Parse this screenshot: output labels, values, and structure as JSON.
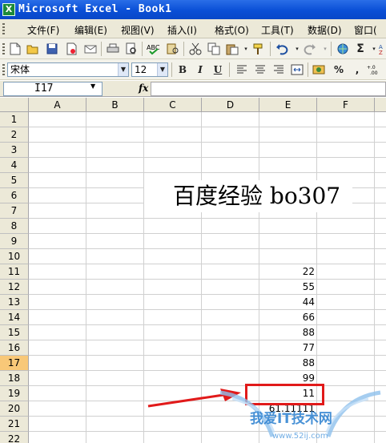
{
  "window": {
    "title": "Microsoft Excel - Book1",
    "app_icon_label": "X"
  },
  "menu": {
    "items": [
      "文件(F)",
      "编辑(E)",
      "视图(V)",
      "插入(I)",
      "格式(O)",
      "工具(T)",
      "数据(D)",
      "窗口("
    ]
  },
  "format_toolbar": {
    "font_name": "宋体",
    "font_size": "12",
    "bold": "B",
    "italic": "I",
    "underline": "U",
    "percent": "%",
    "comma": ","
  },
  "formula_bar": {
    "name_box": "I17",
    "fx": "fx",
    "value": ""
  },
  "columns": [
    "A",
    "B",
    "C",
    "D",
    "E",
    "F"
  ],
  "rows": [
    "1",
    "2",
    "3",
    "4",
    "5",
    "6",
    "7",
    "8",
    "9",
    "10",
    "11",
    "12",
    "13",
    "14",
    "15",
    "16",
    "17",
    "18",
    "19",
    "20",
    "21",
    "22"
  ],
  "active_row": "17",
  "sheet": {
    "heading_text": "百度经验  bo307",
    "column_e_values": [
      {
        "row": "10",
        "value": "22"
      },
      {
        "row": "11",
        "value": "55"
      },
      {
        "row": "12",
        "value": "44"
      },
      {
        "row": "13",
        "value": "66"
      },
      {
        "row": "14",
        "value": "88"
      },
      {
        "row": "15",
        "value": "77"
      },
      {
        "row": "16",
        "value": "88"
      },
      {
        "row": "17",
        "value": "99"
      },
      {
        "row": "18",
        "value": "11"
      },
      {
        "row": "19",
        "value": "61.11111"
      }
    ]
  },
  "annotation": {
    "color": "#e11a1a"
  },
  "watermark": {
    "text": "我爱IT技术网",
    "url": "www.52ij.com"
  }
}
